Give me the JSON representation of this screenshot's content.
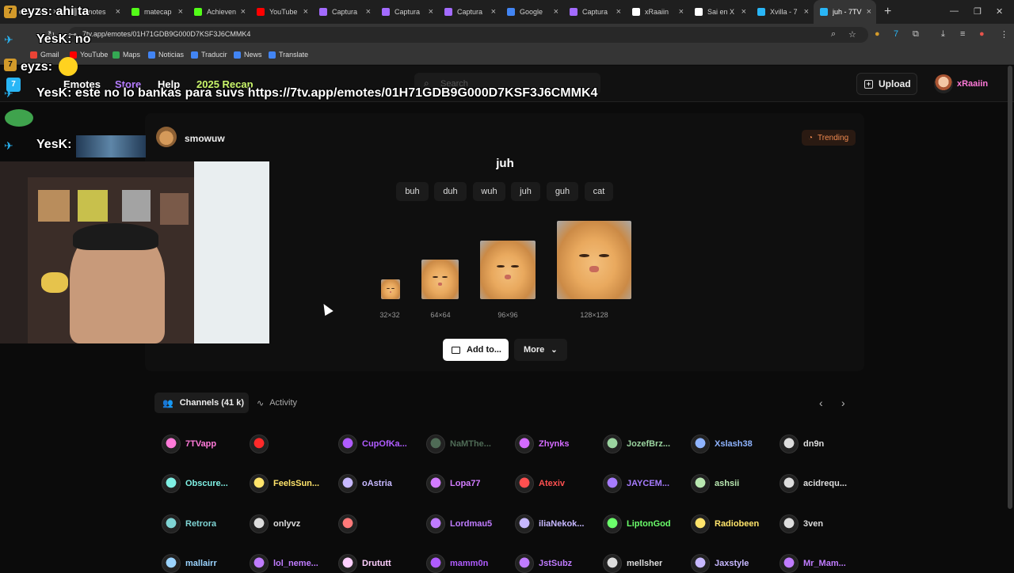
{
  "browser": {
    "tabs": [
      {
        "title": "eyzs: ahi ta",
        "color": "#d39a2a"
      },
      {
        "title": "Emotes",
        "color": "#777"
      },
      {
        "title": "matecap",
        "color": "#53fc18"
      },
      {
        "title": "Achieven",
        "color": "#53fc18"
      },
      {
        "title": "YouTube",
        "color": "#ff0000"
      },
      {
        "title": "Captura",
        "color": "#a36bff"
      },
      {
        "title": "Captura",
        "color": "#a36bff"
      },
      {
        "title": "Captura",
        "color": "#a36bff"
      },
      {
        "title": "Google",
        "color": "#4285f4"
      },
      {
        "title": "Captura",
        "color": "#a36bff"
      },
      {
        "title": "xRaaiin",
        "color": "#ffffff"
      },
      {
        "title": "Sai en X",
        "color": "#ffffff"
      },
      {
        "title": "Xvilla - 7",
        "color": "#29b6f6"
      },
      {
        "title": "juh - 7TV",
        "color": "#29b6f6",
        "active": true
      }
    ],
    "new_tab": "+",
    "url": "7tv.app/emotes/01H71GDB9G000D7KSF3J6CMMK4",
    "bookmarks": [
      {
        "label": "Gmail",
        "color": "#ea4335"
      },
      {
        "label": "YouTube",
        "color": "#ff0000"
      },
      {
        "label": "Maps",
        "color": "#34a853"
      },
      {
        "label": "Noticias",
        "color": "#4285f4"
      },
      {
        "label": "Traducir",
        "color": "#4285f4"
      },
      {
        "label": "News",
        "color": "#4285f4"
      },
      {
        "label": "Translate",
        "color": "#4285f4"
      }
    ]
  },
  "site": {
    "nav": [
      {
        "label": "Emotes",
        "color": "#ffffff"
      },
      {
        "label": "Store",
        "color": "#b57cff"
      },
      {
        "label": "Help",
        "color": "#ffffff"
      },
      {
        "label": "2025 Recap",
        "color": "#c9f56a"
      }
    ],
    "search_placeholder": "Search",
    "upload_label": "Upload",
    "username": "xRaaiin"
  },
  "emote": {
    "owner": "smowuw",
    "trending_label": "Trending",
    "name": "juh",
    "tags": [
      "buh",
      "duh",
      "wuh",
      "juh",
      "guh",
      "cat"
    ],
    "sizes": [
      "32×32",
      "64×64",
      "96×96",
      "128×128"
    ],
    "add_label": "Add to...",
    "more_label": "More"
  },
  "channels": {
    "tab_label": "Channels (41 k)",
    "activity_label": "Activity",
    "list": [
      {
        "name": "7TVapp",
        "color": "#ff7ad9"
      },
      {
        "name": "",
        "color": "#ff2a2a"
      },
      {
        "name": "CupOfKa...",
        "color": "#b05cff"
      },
      {
        "name": "NaMThe...",
        "color": "#4f6b56"
      },
      {
        "name": "Zhynks",
        "color": "#d46bff"
      },
      {
        "name": "JozefBrz...",
        "color": "#9bd4a0"
      },
      {
        "name": "Xslash38",
        "color": "#8fb4ff"
      },
      {
        "name": "dn9n",
        "color": "#dddddd"
      },
      {
        "name": "Obscure...",
        "color": "#7ff0e4"
      },
      {
        "name": "FeelsSun...",
        "color": "#ffe46b"
      },
      {
        "name": "oAstria",
        "color": "#c7b8ff"
      },
      {
        "name": "Lopa77",
        "color": "#d27cff"
      },
      {
        "name": "Atexiv",
        "color": "#ff5050"
      },
      {
        "name": "JAYCEM...",
        "color": "#a77cff"
      },
      {
        "name": "ashsii",
        "color": "#b8e7b0"
      },
      {
        "name": "acidrequ...",
        "color": "#dddddd"
      },
      {
        "name": "Retrora",
        "color": "#7fd4d4"
      },
      {
        "name": "onlyvz",
        "color": "#dddddd"
      },
      {
        "name": "",
        "color": "#ff7a7a"
      },
      {
        "name": "Lordmau5",
        "color": "#c07cff"
      },
      {
        "name": "iliaNekok...",
        "color": "#c7b8ff"
      },
      {
        "name": "LiptonGod",
        "color": "#6bff6b"
      },
      {
        "name": "Radiobeen",
        "color": "#ffe46b"
      },
      {
        "name": "3ven",
        "color": "#dddddd"
      },
      {
        "name": "mallairr",
        "color": "#9bd4ff"
      },
      {
        "name": "lol_neme...",
        "color": "#c07cff"
      },
      {
        "name": "Drututt",
        "color": "#ffd0ff"
      },
      {
        "name": "mamm0n",
        "color": "#b05cff"
      },
      {
        "name": "JstSubz",
        "color": "#c07cff"
      },
      {
        "name": "mellsher",
        "color": "#dddddd"
      },
      {
        "name": "Jaxstyle",
        "color": "#c7b8ff"
      },
      {
        "name": "Mr_Mam...",
        "color": "#c07cff"
      }
    ]
  },
  "overlay": {
    "chat": [
      {
        "user": "eyzs:",
        "text": "ahi ta"
      },
      {
        "user": "YesK:",
        "text": "no"
      },
      {
        "user": "eyzs:",
        "text": ""
      },
      {
        "user": "YesK:",
        "text": "este no lo bankas para suvs https://7tv.app/emotes/01H71GDB9G000D7KSF3J6CMMK4"
      },
      {
        "user": "YesK:",
        "text": ""
      }
    ]
  }
}
